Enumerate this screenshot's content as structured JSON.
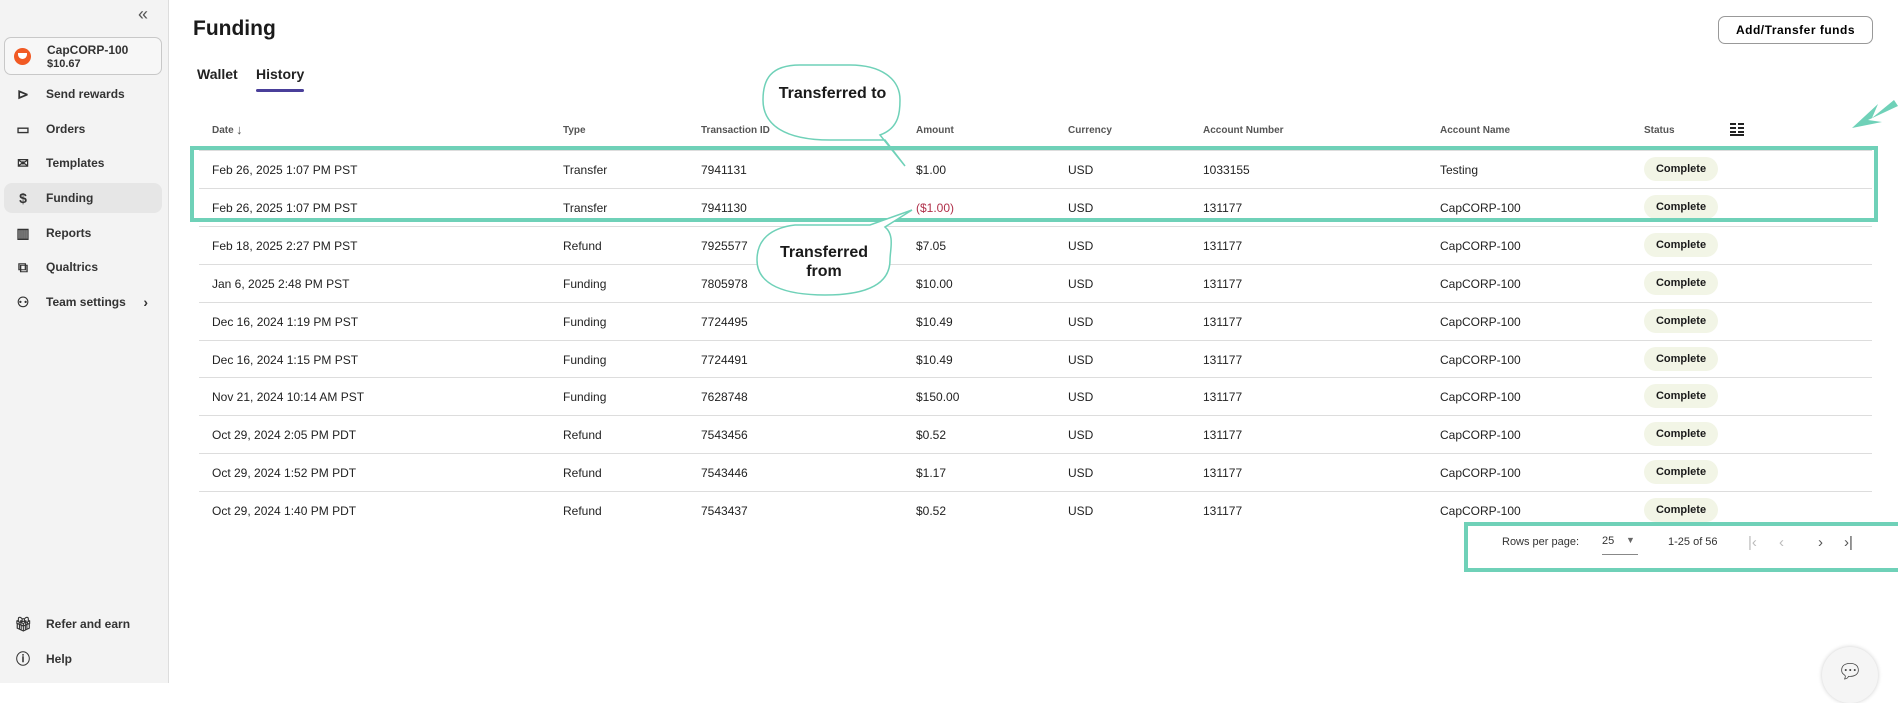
{
  "sidebar": {
    "collapse_icon": "double-chevron-left",
    "account": {
      "name": "CapCORP-100",
      "balance": "$10.67"
    },
    "items": [
      {
        "label": "Send rewards",
        "icon": "send-circle"
      },
      {
        "label": "Orders",
        "icon": "folder"
      },
      {
        "label": "Templates",
        "icon": "envelope"
      },
      {
        "label": "Funding",
        "icon": "dollar",
        "active": true
      },
      {
        "label": "Reports",
        "icon": "bar-chart"
      },
      {
        "label": "Qualtrics",
        "icon": "qualtrics"
      },
      {
        "label": "Team settings",
        "icon": "people"
      }
    ],
    "bottom": [
      {
        "label": "Refer and earn",
        "icon": "gift"
      },
      {
        "label": "Help",
        "icon": "question-circle"
      }
    ]
  },
  "header": {
    "title": "Funding",
    "add_button": "Add/Transfer funds"
  },
  "tabs": [
    {
      "label": "Wallet"
    },
    {
      "label": "History",
      "active": true
    }
  ],
  "table": {
    "columns": [
      "Date",
      "Type",
      "Transaction ID",
      "Amount",
      "Currency",
      "Account Number",
      "Account Name",
      "Status"
    ],
    "rows": [
      [
        "Feb 26, 2025 1:07 PM PST",
        "Transfer",
        "7941131",
        "$1.00",
        "USD",
        "1033155",
        "Testing",
        "Complete"
      ],
      [
        "Feb 26, 2025 1:07 PM PST",
        "Transfer",
        "7941130",
        "($1.00)",
        "USD",
        "131177",
        "CapCORP-100",
        "Complete"
      ],
      [
        "Feb 18, 2025 2:27 PM PST",
        "Refund",
        "7925577",
        "$7.05",
        "USD",
        "131177",
        "CapCORP-100",
        "Complete"
      ],
      [
        "Jan 6, 2025 2:48 PM PST",
        "Funding",
        "7805978",
        "$10.00",
        "USD",
        "131177",
        "CapCORP-100",
        "Complete"
      ],
      [
        "Dec 16, 2024 1:19 PM PST",
        "Funding",
        "7724495",
        "$10.49",
        "USD",
        "131177",
        "CapCORP-100",
        "Complete"
      ],
      [
        "Dec 16, 2024 1:15 PM PST",
        "Funding",
        "7724491",
        "$10.49",
        "USD",
        "131177",
        "CapCORP-100",
        "Complete"
      ],
      [
        "Nov 21, 2024 10:14 AM PST",
        "Funding",
        "7628748",
        "$150.00",
        "USD",
        "131177",
        "CapCORP-100",
        "Complete"
      ],
      [
        "Oct 29, 2024 2:05 PM PDT",
        "Refund",
        "7543456",
        "$0.52",
        "USD",
        "131177",
        "CapCORP-100",
        "Complete"
      ],
      [
        "Oct 29, 2024 1:52 PM PDT",
        "Refund",
        "7543446",
        "$1.17",
        "USD",
        "131177",
        "CapCORP-100",
        "Complete"
      ],
      [
        "Oct 29, 2024 1:40 PM PDT",
        "Refund",
        "7543437",
        "$0.52",
        "USD",
        "131177",
        "CapCORP-100",
        "Complete"
      ]
    ]
  },
  "pagination": {
    "rows_label": "Rows per page:",
    "rows_value": "25",
    "range": "1-25 of 56"
  },
  "annotations": {
    "callout_to": "Transferred to",
    "callout_from": "Transferred from",
    "highlight_color": "#6fd1b8"
  },
  "colors": {
    "accent": "#4a3f9a",
    "negative": "#b0304a",
    "badge_bg": "#f2f5e6"
  }
}
